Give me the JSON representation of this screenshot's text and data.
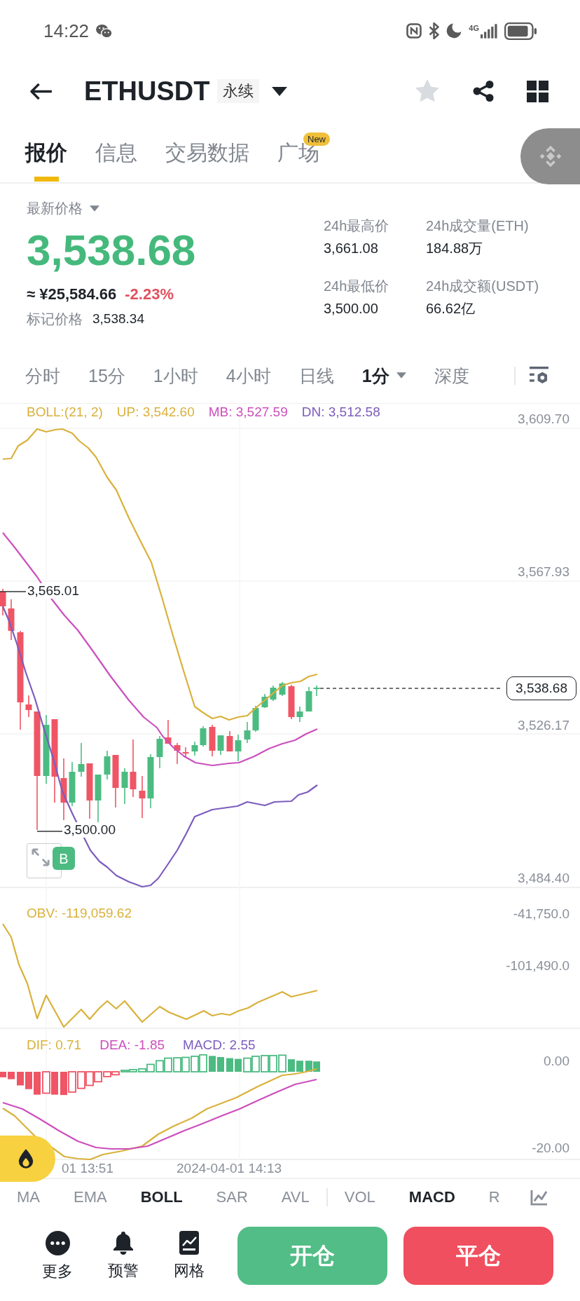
{
  "status_bar": {
    "time": "14:22",
    "network": "4G"
  },
  "header": {
    "symbol": "ETHUSDT",
    "contract_tag": "永续",
    "favorited": false
  },
  "tabs": [
    {
      "label": "报价",
      "selected": true
    },
    {
      "label": "信息",
      "selected": false
    },
    {
      "label": "交易数据",
      "selected": false
    },
    {
      "label": "广场",
      "selected": false,
      "badge": "New"
    }
  ],
  "price": {
    "label": "最新价格",
    "last": "3,538.68",
    "fiat": "≈ ¥25,584.66",
    "change": "-2.23%",
    "mark_label": "标记价格",
    "mark": "3,538.34"
  },
  "stats": [
    {
      "label": "24h最高价",
      "value": "3,661.08"
    },
    {
      "label": "24h成交量(ETH)",
      "value": "184.88万"
    },
    {
      "label": "24h最低价",
      "value": "3,500.00"
    },
    {
      "label": "24h成交额(USDT)",
      "value": "66.62亿"
    }
  ],
  "intervals": [
    {
      "label": "分时",
      "selected": false
    },
    {
      "label": "15分",
      "selected": false
    },
    {
      "label": "1小时",
      "selected": false
    },
    {
      "label": "4小时",
      "selected": false
    },
    {
      "label": "日线",
      "selected": false
    },
    {
      "label": "1分",
      "selected": true,
      "has_menu": true
    },
    {
      "label": "深度",
      "selected": false
    }
  ],
  "main_chart": {
    "legend": [
      {
        "text": "BOLL:(21, 2)",
        "color": "#d9b13c"
      },
      {
        "text": "UP: 3,542.60",
        "color": "#d9b13c"
      },
      {
        "text": "MB: 3,527.59",
        "color": "#cc4fbd"
      },
      {
        "text": "DN: 3,512.58",
        "color": "#7d5cbd"
      }
    ],
    "y_labels": [
      "3,609.70",
      "3,567.93",
      "3,526.17",
      "3,484.40"
    ],
    "high_label": "3,565.01",
    "low_label": "3,500.00",
    "last_price": "3,538.68",
    "trade_marker": "B"
  },
  "obv_chart": {
    "legend": [
      {
        "text": "OBV: -119,059.62",
        "color": "#d9b13c"
      }
    ],
    "y_labels": [
      "-41,750.0",
      "-101,490.0"
    ]
  },
  "macd_chart": {
    "legend": [
      {
        "text": "DIF: 0.71",
        "color": "#d9b13c"
      },
      {
        "text": "DEA: -1.85",
        "color": "#cc4fbd"
      },
      {
        "text": "MACD: 2.55",
        "color": "#7d5cbd"
      }
    ],
    "y_labels": [
      "0.00",
      "-20.00"
    ]
  },
  "time_axis": [
    "01 13:51",
    "2024-04-01 14:13"
  ],
  "main_indicators": [
    {
      "label": "MA",
      "selected": false
    },
    {
      "label": "EMA",
      "selected": false
    },
    {
      "label": "BOLL",
      "selected": true
    },
    {
      "label": "SAR",
      "selected": false
    },
    {
      "label": "AVL",
      "selected": false
    }
  ],
  "sub_indicators": [
    {
      "label": "VOL",
      "selected": false
    },
    {
      "label": "MACD",
      "selected": true
    },
    {
      "label": "R",
      "selected": false
    }
  ],
  "actions": [
    {
      "kind": "more",
      "label": "更多"
    },
    {
      "kind": "alert",
      "label": "预警"
    },
    {
      "kind": "grid",
      "label": "网格"
    }
  ],
  "trade_buttons": [
    {
      "kind": "open",
      "label": "开仓"
    },
    {
      "kind": "close",
      "label": "平仓"
    }
  ]
}
